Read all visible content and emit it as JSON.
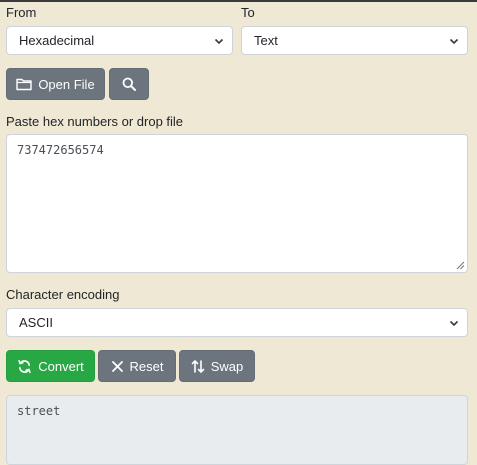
{
  "from": {
    "label": "From",
    "selected": "Hexadecimal"
  },
  "to": {
    "label": "To",
    "selected": "Text"
  },
  "actions": {
    "open_file_label": "Open File"
  },
  "input": {
    "label": "Paste hex numbers or drop file",
    "value": "737472656574"
  },
  "encoding": {
    "label": "Character encoding",
    "selected": "ASCII"
  },
  "buttons": {
    "convert": "Convert",
    "reset": "Reset",
    "swap": "Swap"
  },
  "output": {
    "value": "street"
  },
  "icons": {
    "open_file": "folder-icon",
    "search": "search-icon",
    "convert": "sync-icon",
    "reset": "close-icon",
    "swap": "swap-vertical-icon"
  },
  "colors": {
    "background": "#efe8d4",
    "grey_button": "#6c757d",
    "green_button": "#28a745"
  }
}
